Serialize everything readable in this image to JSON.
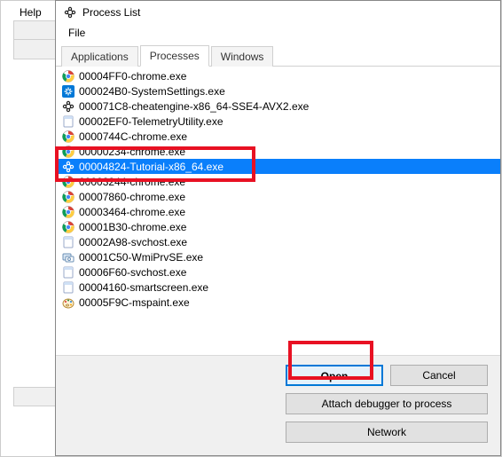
{
  "parent_menu": {
    "help": "Help"
  },
  "dialog": {
    "title": "Process List",
    "menu": {
      "file": "File"
    },
    "tabs": {
      "applications": "Applications",
      "processes": "Processes",
      "windows": "Windows"
    },
    "buttons": {
      "open": "Open",
      "cancel": "Cancel",
      "attach": "Attach debugger to process",
      "network": "Network"
    }
  },
  "processes": [
    {
      "icon": "chrome",
      "label": "00004FF0-chrome.exe"
    },
    {
      "icon": "settings",
      "label": "000024B0-SystemSettings.exe"
    },
    {
      "icon": "ce",
      "label": "000071C8-cheatengine-x86_64-SSE4-AVX2.exe"
    },
    {
      "icon": "blank",
      "label": "00002EF0-TelemetryUtility.exe"
    },
    {
      "icon": "chrome",
      "label": "0000744C-chrome.exe"
    },
    {
      "icon": "chrome",
      "label": "00000234-chrome.exe"
    },
    {
      "icon": "ce",
      "label": "00004824-Tutorial-x86_64.exe",
      "selected": true
    },
    {
      "icon": "chrome",
      "label": "00003244-chrome.exe"
    },
    {
      "icon": "chrome",
      "label": "00007860-chrome.exe"
    },
    {
      "icon": "chrome",
      "label": "00003464-chrome.exe"
    },
    {
      "icon": "chrome",
      "label": "00001B30-chrome.exe"
    },
    {
      "icon": "blank",
      "label": "00002A98-svchost.exe"
    },
    {
      "icon": "wmi",
      "label": "00001C50-WmiPrvSE.exe"
    },
    {
      "icon": "blank",
      "label": "00006F60-svchost.exe"
    },
    {
      "icon": "blank",
      "label": "00004160-smartscreen.exe"
    },
    {
      "icon": "paint",
      "label": "00005F9C-mspaint.exe"
    }
  ]
}
